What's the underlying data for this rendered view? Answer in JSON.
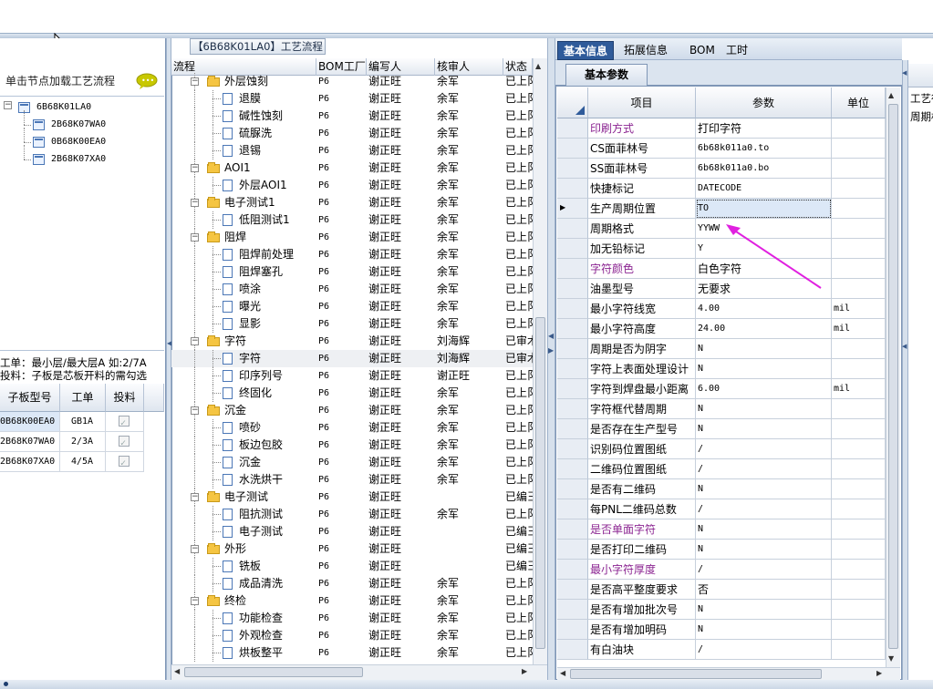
{
  "colors": {
    "accent": "#2f5b9a",
    "purple_label": "#8b2491",
    "arrow": "#e020e0",
    "selected_cell": "#dce8f7"
  },
  "left": {
    "hint": "单击节点加载工艺流程",
    "tree": [
      {
        "label": "6B68K01LA0",
        "level": 0
      },
      {
        "label": "2B68K07WA0",
        "level": 1
      },
      {
        "label": "0B68K00EA0",
        "level": 1
      },
      {
        "label": "2B68K07XA0",
        "level": 1
      }
    ],
    "info_line1": "工单：最小层/最大层A 如:2/7A",
    "info_line2": "投料：子板是芯板开料的需勾选",
    "grid_headers": [
      "子板型号",
      "工单",
      "投料"
    ],
    "grid_rows": [
      {
        "model": "0B68K00EA0",
        "order": "GB1A"
      },
      {
        "model": "2B68K07WA0",
        "order": "2/3A"
      },
      {
        "model": "2B68K07XA0",
        "order": "4/5A"
      }
    ]
  },
  "middle": {
    "title": "【6B68K01LA0】工艺流程",
    "headers": [
      "流程",
      "BOM工厂",
      "编写人",
      "核审人",
      "状态"
    ],
    "rows": [
      {
        "name": "外层蚀刻",
        "type": "group",
        "bom": "P6",
        "author": "谢正旺",
        "reviewer": "余军",
        "status": "已上阝"
      },
      {
        "name": "退膜",
        "type": "item",
        "bom": "P6",
        "author": "谢正旺",
        "reviewer": "余军",
        "status": "已上阝"
      },
      {
        "name": "碱性蚀刻",
        "type": "item",
        "bom": "P6",
        "author": "谢正旺",
        "reviewer": "余军",
        "status": "已上阝"
      },
      {
        "name": "硫脲洗",
        "type": "item",
        "bom": "P6",
        "author": "谢正旺",
        "reviewer": "余军",
        "status": "已上阝"
      },
      {
        "name": "退锡",
        "type": "item",
        "bom": "P6",
        "author": "谢正旺",
        "reviewer": "余军",
        "status": "已上阝"
      },
      {
        "name": "AOI1",
        "type": "group",
        "bom": "P6",
        "author": "谢正旺",
        "reviewer": "余军",
        "status": "已上阝"
      },
      {
        "name": "外层AOI1",
        "type": "item",
        "bom": "P6",
        "author": "谢正旺",
        "reviewer": "余军",
        "status": "已上阝"
      },
      {
        "name": "电子测试1",
        "type": "group",
        "bom": "P6",
        "author": "谢正旺",
        "reviewer": "余军",
        "status": "已上阝"
      },
      {
        "name": "低阻测试1",
        "type": "item",
        "bom": "P6",
        "author": "谢正旺",
        "reviewer": "余军",
        "status": "已上阝"
      },
      {
        "name": "阻焊",
        "type": "group",
        "bom": "P6",
        "author": "谢正旺",
        "reviewer": "余军",
        "status": "已上阝"
      },
      {
        "name": "阻焊前处理",
        "type": "item",
        "bom": "P6",
        "author": "谢正旺",
        "reviewer": "余军",
        "status": "已上阝"
      },
      {
        "name": "阻焊塞孔",
        "type": "item",
        "bom": "P6",
        "author": "谢正旺",
        "reviewer": "余军",
        "status": "已上阝"
      },
      {
        "name": "喷涂",
        "type": "item",
        "bom": "P6",
        "author": "谢正旺",
        "reviewer": "余军",
        "status": "已上阝"
      },
      {
        "name": "曝光",
        "type": "item",
        "bom": "P6",
        "author": "谢正旺",
        "reviewer": "余军",
        "status": "已上阝"
      },
      {
        "name": "显影",
        "type": "item",
        "bom": "P6",
        "author": "谢正旺",
        "reviewer": "余军",
        "status": "已上阝"
      },
      {
        "name": "字符",
        "type": "group",
        "bom": "P6",
        "author": "谢正旺",
        "reviewer": "刘海辉",
        "status": "已审木"
      },
      {
        "name": "字符",
        "type": "item",
        "bom": "P6",
        "author": "谢正旺",
        "reviewer": "刘海辉",
        "status": "已审木",
        "selected": true
      },
      {
        "name": "印序列号",
        "type": "item",
        "bom": "P6",
        "author": "谢正旺",
        "reviewer": "谢正旺",
        "status": "已上阝"
      },
      {
        "name": "终固化",
        "type": "item",
        "bom": "P6",
        "author": "谢正旺",
        "reviewer": "余军",
        "status": "已上阝"
      },
      {
        "name": "沉金",
        "type": "group",
        "bom": "P6",
        "author": "谢正旺",
        "reviewer": "余军",
        "status": "已上阝"
      },
      {
        "name": "喷砂",
        "type": "item",
        "bom": "P6",
        "author": "谢正旺",
        "reviewer": "余军",
        "status": "已上阝"
      },
      {
        "name": "板边包胶",
        "type": "item",
        "bom": "P6",
        "author": "谢正旺",
        "reviewer": "余军",
        "status": "已上阝"
      },
      {
        "name": "沉金",
        "type": "item",
        "bom": "P6",
        "author": "谢正旺",
        "reviewer": "余军",
        "status": "已上阝"
      },
      {
        "name": "水洗烘干",
        "type": "item",
        "bom": "P6",
        "author": "谢正旺",
        "reviewer": "余军",
        "status": "已上阝"
      },
      {
        "name": "电子测试",
        "type": "group",
        "bom": "P6",
        "author": "谢正旺",
        "reviewer": "",
        "status": "已编彐"
      },
      {
        "name": "阻抗测试",
        "type": "item",
        "bom": "P6",
        "author": "谢正旺",
        "reviewer": "余军",
        "status": "已上阝"
      },
      {
        "name": "电子测试",
        "type": "item",
        "bom": "P6",
        "author": "谢正旺",
        "reviewer": "",
        "status": "已编彐"
      },
      {
        "name": "外形",
        "type": "group",
        "bom": "P6",
        "author": "谢正旺",
        "reviewer": "",
        "status": "已编彐"
      },
      {
        "name": "铣板",
        "type": "item",
        "bom": "P6",
        "author": "谢正旺",
        "reviewer": "",
        "status": "已编彐"
      },
      {
        "name": "成品清洗",
        "type": "item",
        "bom": "P6",
        "author": "谢正旺",
        "reviewer": "余军",
        "status": "已上阝"
      },
      {
        "name": "终检",
        "type": "group",
        "bom": "P6",
        "author": "谢正旺",
        "reviewer": "余军",
        "status": "已上阝"
      },
      {
        "name": "功能检查",
        "type": "item",
        "bom": "P6",
        "author": "谢正旺",
        "reviewer": "余军",
        "status": "已上阝"
      },
      {
        "name": "外观检查",
        "type": "item",
        "bom": "P6",
        "author": "谢正旺",
        "reviewer": "余军",
        "status": "已上阝"
      },
      {
        "name": "烘板整平",
        "type": "item",
        "bom": "P6",
        "author": "谢正旺",
        "reviewer": "余军",
        "status": "已上阝"
      }
    ]
  },
  "right": {
    "tabs": [
      "基本信息",
      "拓展信息",
      "BOM",
      "工时"
    ],
    "subtab": "基本参数",
    "headers": [
      "项目",
      "参数",
      "单位"
    ],
    "rows": [
      {
        "name": "印刷方式",
        "value": "打印字符",
        "unit": "",
        "purple": true
      },
      {
        "name": "CS面菲林号",
        "value": "6b68k011a0.to",
        "unit": ""
      },
      {
        "name": "SS面菲林号",
        "value": "6b68k011a0.bo",
        "unit": ""
      },
      {
        "name": "快捷标记",
        "value": "DATECODE",
        "unit": ""
      },
      {
        "name": "生产周期位置",
        "value": "TO",
        "unit": "",
        "selected": true
      },
      {
        "name": "周期格式",
        "value": "YYWW",
        "unit": ""
      },
      {
        "name": "加无铅标记",
        "value": "Y",
        "unit": ""
      },
      {
        "name": "字符颜色",
        "value": "白色字符",
        "unit": "",
        "purple": true
      },
      {
        "name": "油墨型号",
        "value": "无要求",
        "unit": ""
      },
      {
        "name": "最小字符线宽",
        "value": "4.00",
        "unit": "mil"
      },
      {
        "name": "最小字符高度",
        "value": "24.00",
        "unit": "mil"
      },
      {
        "name": "周期是否为阴字",
        "value": "N",
        "unit": ""
      },
      {
        "name": "字符上表面处理设计",
        "value": "N",
        "unit": ""
      },
      {
        "name": "字符到焊盘最小距离",
        "value": "6.00",
        "unit": "mil"
      },
      {
        "name": "字符框代替周期",
        "value": "N",
        "unit": ""
      },
      {
        "name": "是否存在生产型号",
        "value": "N",
        "unit": ""
      },
      {
        "name": "识别码位置图纸",
        "value": "/",
        "unit": ""
      },
      {
        "name": "二维码位置图纸",
        "value": "/",
        "unit": ""
      },
      {
        "name": "是否有二维码",
        "value": "N",
        "unit": ""
      },
      {
        "name": "每PNL二维码总数",
        "value": "/",
        "unit": ""
      },
      {
        "name": "是否单面字符",
        "value": "N",
        "unit": "",
        "purple": true
      },
      {
        "name": "是否打印二维码",
        "value": "N",
        "unit": ""
      },
      {
        "name": "最小字符厚度",
        "value": "/",
        "unit": "",
        "purple": true
      },
      {
        "name": "是否高平整度要求",
        "value": "否",
        "unit": ""
      },
      {
        "name": "是否有增加批次号",
        "value": "N",
        "unit": ""
      },
      {
        "name": "是否有增加明码",
        "value": "N",
        "unit": ""
      },
      {
        "name": "有白油块",
        "value": "/",
        "unit": ""
      }
    ]
  },
  "far_right": {
    "label1": "工艺行",
    "label2": "周期标"
  }
}
